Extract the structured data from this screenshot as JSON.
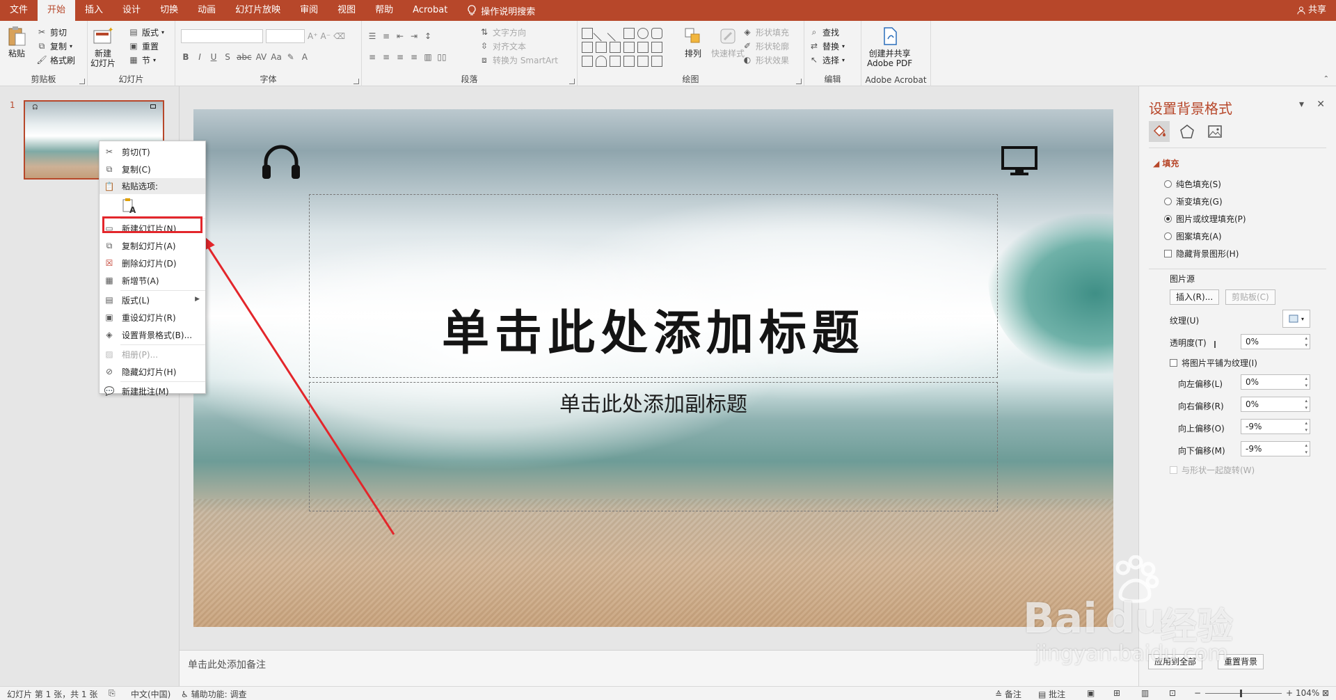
{
  "menubar": {
    "tabs": [
      "文件",
      "开始",
      "插入",
      "设计",
      "切换",
      "动画",
      "幻灯片放映",
      "审阅",
      "视图",
      "帮助",
      "Acrobat"
    ],
    "active_tab": "开始",
    "tell_me": "操作说明搜索",
    "share": "共享"
  },
  "ribbon": {
    "clipboard": {
      "paste": "粘贴",
      "cut": "剪切",
      "copy": "复制",
      "format_painter": "格式刷",
      "label": "剪贴板"
    },
    "slides": {
      "new_slide_1": "新建",
      "new_slide_2": "幻灯片",
      "layout": "版式",
      "reset": "重置",
      "section": "节",
      "label": "幻灯片"
    },
    "font": {
      "label": "字体",
      "format_buttons": [
        "B",
        "I",
        "U",
        "S",
        "abc",
        "AV",
        "Aa",
        "A"
      ]
    },
    "paragraph": {
      "text_direction": "文字方向",
      "align_text": "对齐文本",
      "smartart": "转换为 SmartArt",
      "label": "段落"
    },
    "drawing": {
      "arrange": "排列",
      "quick_styles": "快速样式",
      "shape_fill": "形状填充",
      "shape_outline": "形状轮廓",
      "shape_effects": "形状效果",
      "label": "绘图"
    },
    "editing": {
      "find": "查找",
      "replace": "替换",
      "select": "选择",
      "label": "编辑"
    },
    "acrobat": {
      "create_1": "创建并共享",
      "create_2": "Adobe PDF",
      "label": "Adobe Acrobat"
    }
  },
  "thumbnails": {
    "slide_number": "1"
  },
  "context_menu": {
    "cut": "剪切(T)",
    "copy": "复制(C)",
    "paste_options": "粘贴选项:",
    "new_slide": "新建幻灯片(N)",
    "duplicate_slide": "复制幻灯片(A)",
    "delete_slide": "删除幻灯片(D)",
    "add_section": "新增节(A)",
    "layout": "版式(L)",
    "reset_slide": "重设幻灯片(R)",
    "format_background": "设置背景格式(B)...",
    "photo_album": "相册(P)...",
    "hide_slide": "隐藏幻灯片(H)",
    "new_comment": "新建批注(M)"
  },
  "slide": {
    "title_placeholder": "单击此处添加标题",
    "subtitle_placeholder": "单击此处添加副标题"
  },
  "format_pane": {
    "title": "设置背景格式",
    "fill_section": "填充",
    "solid_fill": "纯色填充(S)",
    "gradient_fill": "渐变填充(G)",
    "picture_fill": "图片或纹理填充(P)",
    "pattern_fill": "图案填充(A)",
    "hide_bg_graphics": "隐藏背景图形(H)",
    "picture_source": "图片源",
    "insert": "插入(R)...",
    "clipboard": "剪贴板(C)",
    "texture": "纹理(U)",
    "transparency": "透明度(T)",
    "transparency_value": "0%",
    "tile_picture": "将图片平铺为纹理(I)",
    "offset_left": "向左偏移(L)",
    "offset_left_value": "0%",
    "offset_right": "向右偏移(R)",
    "offset_right_value": "0%",
    "offset_top": "向上偏移(O)",
    "offset_top_value": "-9%",
    "offset_bottom": "向下偏移(M)",
    "offset_bottom_value": "-9%",
    "rotate_with_shape": "与形状一起旋转(W)"
  },
  "notes": {
    "placeholder": "单击此处添加备注",
    "apply_all": "应用到全部",
    "reset_bg": "重置背景"
  },
  "status": {
    "slide_info": "幻灯片 第 1 张，共 1 张",
    "language": "中文(中国)",
    "accessibility": "辅助功能: 调查",
    "notes": "备注",
    "comments": "批注",
    "zoom": "104%"
  },
  "watermark": {
    "brand": "Bai",
    "brand_du": "du",
    "jingyan": "经验",
    "url": "jingyan.baidu.com"
  },
  "colors": {
    "accent": "#b7472a",
    "highlight": "#e3262b"
  }
}
